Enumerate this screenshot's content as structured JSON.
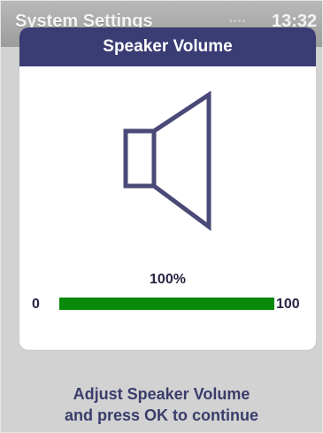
{
  "background_screen": {
    "title": "System Settings",
    "signal": "▪▪▪▪",
    "time": "13:32"
  },
  "dialog": {
    "title": "Speaker Volume",
    "icon": "speaker-icon",
    "volume": {
      "percent_label": "100%",
      "value": 100,
      "min_label": "0",
      "max_label": "100",
      "min": 0,
      "max": 100,
      "fill_color": "#0a8a0a"
    }
  },
  "instructions": {
    "line1": "Adjust Speaker Volume",
    "line2": "and press OK to continue"
  },
  "colors": {
    "header": "#3a3c74",
    "text": "#3a3d6b"
  }
}
